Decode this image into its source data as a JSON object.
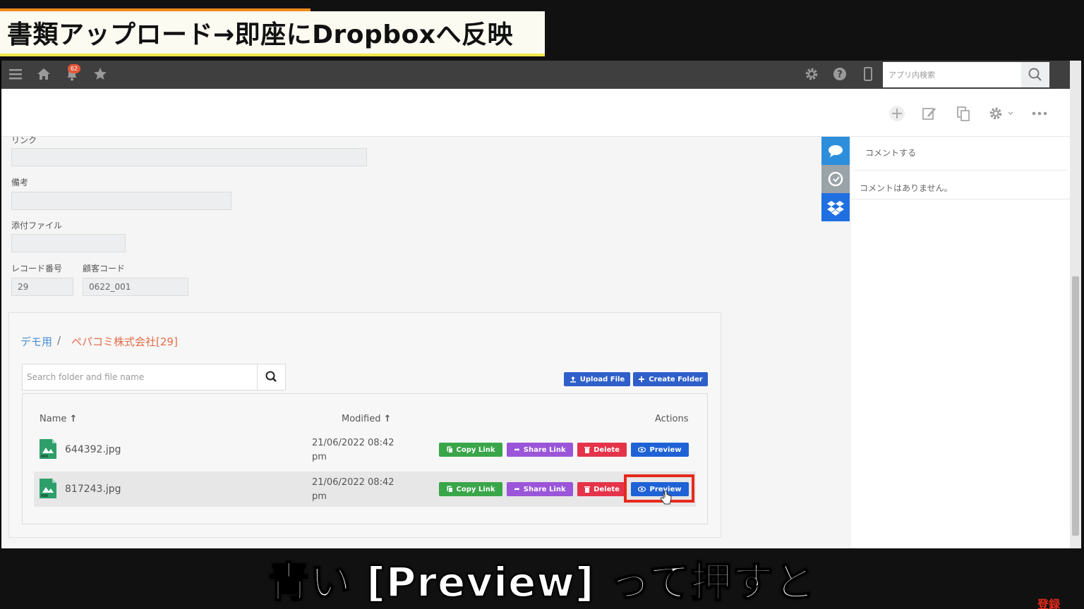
{
  "video": {
    "top_caption": "書類アップロード→即座にDropboxへ反映",
    "bottom_caption": "青い [Preview] って押すと",
    "register_badge": "登録"
  },
  "header": {
    "notification_count": "62",
    "search_placeholder": "アプリ内検索"
  },
  "form": {
    "fields": [
      {
        "label": "リンク",
        "value": ""
      },
      {
        "label": "備考",
        "value": ""
      },
      {
        "label": "添付ファイル",
        "value": ""
      },
      {
        "label": "レコード番号",
        "value": "29"
      },
      {
        "label": "顧客コード",
        "value": "0622_001"
      }
    ]
  },
  "dropbox": {
    "breadcrumb_root": "デモ用",
    "breadcrumb_sep": "/",
    "breadcrumb_current": "ペパコミ株式会社[29]",
    "search_placeholder": "Search folder and file name",
    "upload_label": "Upload File",
    "create_folder_label": "Create Folder",
    "columns": {
      "name": "Name",
      "modified": "Modified",
      "actions": "Actions"
    },
    "files": [
      {
        "name": "644392.jpg",
        "modified_line1": "21/06/2022 08:42",
        "modified_line2": "pm"
      },
      {
        "name": "817243.jpg",
        "modified_line1": "21/06/2022 08:42",
        "modified_line2": "pm"
      }
    ],
    "actions": {
      "copy": "Copy Link",
      "share": "Share Link",
      "delete": "Delete",
      "preview": "Preview"
    }
  },
  "comments": {
    "input_placeholder": "コメントする",
    "empty_text": "コメントはありません。"
  },
  "colors": {
    "header_bg": "#3f3f3f",
    "accent_blue": "#2f5fc9",
    "highlight_red": "#e62a1c",
    "dropbox_blue": "#1f6fe0"
  }
}
